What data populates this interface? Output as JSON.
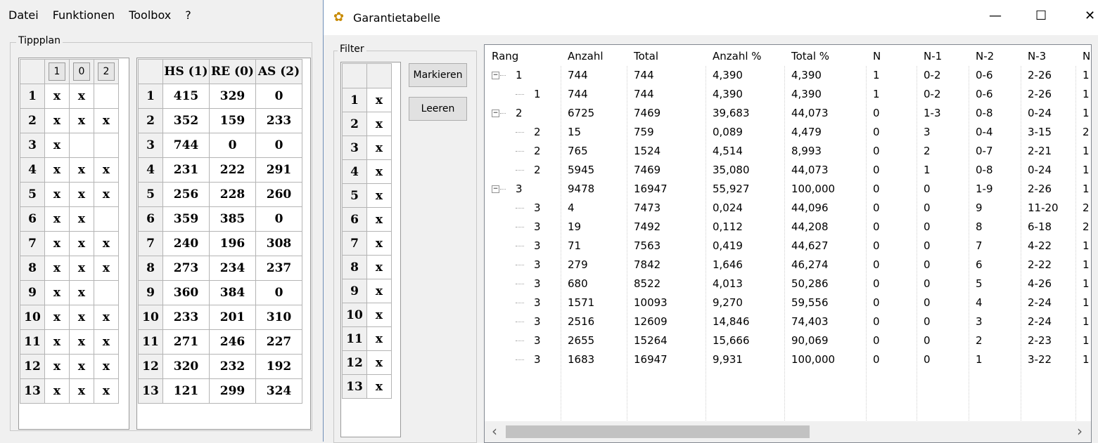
{
  "menu": [
    "Datei",
    "Funktionen",
    "Toolbox",
    "?"
  ],
  "tippplan": {
    "legend": "Tippplan",
    "col_headers": [
      "1",
      "0",
      "2"
    ],
    "rows": [
      [
        "1",
        "x",
        "x",
        ""
      ],
      [
        "2",
        "x",
        "x",
        "x"
      ],
      [
        "3",
        "x",
        "",
        ""
      ],
      [
        "4",
        "x",
        "x",
        "x"
      ],
      [
        "5",
        "x",
        "x",
        "x"
      ],
      [
        "6",
        "x",
        "x",
        ""
      ],
      [
        "7",
        "x",
        "x",
        "x"
      ],
      [
        "8",
        "x",
        "x",
        "x"
      ],
      [
        "9",
        "x",
        "x",
        ""
      ],
      [
        "10",
        "x",
        "x",
        "x"
      ],
      [
        "11",
        "x",
        "x",
        "x"
      ],
      [
        "12",
        "x",
        "x",
        "x"
      ],
      [
        "13",
        "x",
        "x",
        "x"
      ]
    ]
  },
  "stats": {
    "col_headers": [
      "HS (1)",
      "RE (0)",
      "AS (2)"
    ],
    "rows": [
      [
        "1",
        "415",
        "329",
        "0"
      ],
      [
        "2",
        "352",
        "159",
        "233"
      ],
      [
        "3",
        "744",
        "0",
        "0"
      ],
      [
        "4",
        "231",
        "222",
        "291"
      ],
      [
        "5",
        "256",
        "228",
        "260"
      ],
      [
        "6",
        "359",
        "385",
        "0"
      ],
      [
        "7",
        "240",
        "196",
        "308"
      ],
      [
        "8",
        "273",
        "234",
        "237"
      ],
      [
        "9",
        "360",
        "384",
        "0"
      ],
      [
        "10",
        "233",
        "201",
        "310"
      ],
      [
        "11",
        "271",
        "246",
        "227"
      ],
      [
        "12",
        "320",
        "232",
        "192"
      ],
      [
        "13",
        "121",
        "299",
        "324"
      ]
    ]
  },
  "window": {
    "title": "Garantietabelle",
    "minimize": "—",
    "maximize": "☐",
    "close": "✕",
    "filter_legend": "Filter",
    "filter_rows": [
      [
        "1",
        "x"
      ],
      [
        "2",
        "x"
      ],
      [
        "3",
        "x"
      ],
      [
        "4",
        "x"
      ],
      [
        "5",
        "x"
      ],
      [
        "6",
        "x"
      ],
      [
        "7",
        "x"
      ],
      [
        "8",
        "x"
      ],
      [
        "9",
        "x"
      ],
      [
        "10",
        "x"
      ],
      [
        "11",
        "x"
      ],
      [
        "12",
        "x"
      ],
      [
        "13",
        "x"
      ]
    ],
    "btn_markieren": "Markieren",
    "btn_leeren": "Leeren",
    "columns": [
      "Rang",
      "Anzahl",
      "Total",
      "Anzahl %",
      "Total %",
      "N",
      "N-1",
      "N-2",
      "N-3",
      "N"
    ],
    "rows": [
      {
        "level": 0,
        "exp": "−",
        "v": [
          "1",
          "744",
          "744",
          "4,390",
          "4,390",
          "1",
          "0-2",
          "0-6",
          "2-26",
          "1"
        ]
      },
      {
        "level": 1,
        "exp": "",
        "v": [
          "1",
          "744",
          "744",
          "4,390",
          "4,390",
          "1",
          "0-2",
          "0-6",
          "2-26",
          "1"
        ]
      },
      {
        "level": 0,
        "exp": "−",
        "v": [
          "2",
          "6725",
          "7469",
          "39,683",
          "44,073",
          "0",
          "1-3",
          "0-8",
          "0-24",
          "1"
        ]
      },
      {
        "level": 1,
        "exp": "",
        "v": [
          "2",
          "15",
          "759",
          "0,089",
          "4,479",
          "0",
          "3",
          "0-4",
          "3-15",
          "2"
        ]
      },
      {
        "level": 1,
        "exp": "",
        "v": [
          "2",
          "765",
          "1524",
          "4,514",
          "8,993",
          "0",
          "2",
          "0-7",
          "2-21",
          "1"
        ]
      },
      {
        "level": 1,
        "exp": "",
        "v": [
          "2",
          "5945",
          "7469",
          "35,080",
          "44,073",
          "0",
          "1",
          "0-8",
          "0-24",
          "1"
        ]
      },
      {
        "level": 0,
        "exp": "−",
        "v": [
          "3",
          "9478",
          "16947",
          "55,927",
          "100,000",
          "0",
          "0",
          "1-9",
          "2-26",
          "1"
        ]
      },
      {
        "level": 1,
        "exp": "",
        "v": [
          "3",
          "4",
          "7473",
          "0,024",
          "44,096",
          "0",
          "0",
          "9",
          "11-20",
          "2"
        ]
      },
      {
        "level": 1,
        "exp": "",
        "v": [
          "3",
          "19",
          "7492",
          "0,112",
          "44,208",
          "0",
          "0",
          "8",
          "6-18",
          "2"
        ]
      },
      {
        "level": 1,
        "exp": "",
        "v": [
          "3",
          "71",
          "7563",
          "0,419",
          "44,627",
          "0",
          "0",
          "7",
          "4-22",
          "1"
        ]
      },
      {
        "level": 1,
        "exp": "",
        "v": [
          "3",
          "279",
          "7842",
          "1,646",
          "46,274",
          "0",
          "0",
          "6",
          "2-22",
          "1"
        ]
      },
      {
        "level": 1,
        "exp": "",
        "v": [
          "3",
          "680",
          "8522",
          "4,013",
          "50,286",
          "0",
          "0",
          "5",
          "4-26",
          "1"
        ]
      },
      {
        "level": 1,
        "exp": "",
        "v": [
          "3",
          "1571",
          "10093",
          "9,270",
          "59,556",
          "0",
          "0",
          "4",
          "2-24",
          "1"
        ]
      },
      {
        "level": 1,
        "exp": "",
        "v": [
          "3",
          "2516",
          "12609",
          "14,846",
          "74,403",
          "0",
          "0",
          "3",
          "2-24",
          "1"
        ]
      },
      {
        "level": 1,
        "exp": "",
        "v": [
          "3",
          "2655",
          "15264",
          "15,666",
          "90,069",
          "0",
          "0",
          "2",
          "2-23",
          "1"
        ]
      },
      {
        "level": 1,
        "exp": "",
        "v": [
          "3",
          "1683",
          "16947",
          "9,931",
          "100,000",
          "0",
          "0",
          "1",
          "3-22",
          "1"
        ]
      }
    ],
    "scroll_left": "‹",
    "scroll_right": "›"
  },
  "colors": {
    "window_border": "#6f8fb8",
    "grid_border": "#b4b4b4",
    "background": "#f0f0f0"
  }
}
